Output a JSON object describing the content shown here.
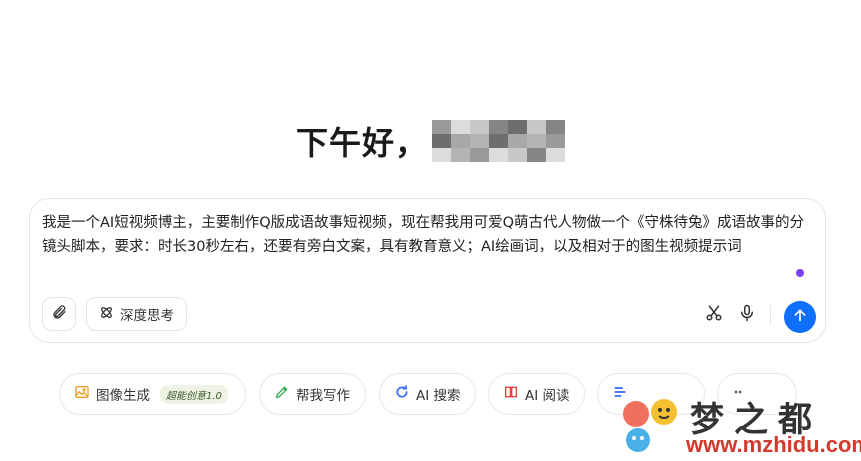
{
  "greeting": {
    "text": "下午好，"
  },
  "composer": {
    "prompt": "我是一个AI短视频博主，主要制作Q版成语故事短视频，现在帮我用可爱Q萌古代人物做一个《守株待兔》成语故事的分镜头脚本，要求：时长30秒左右，还要有旁白文案，具有教育意义；AI绘画词，以及相对于的图生视频提示词",
    "think_label": "深度思考",
    "icons": {
      "attach": "paperclip-icon",
      "think": "atom-icon",
      "cut": "scissors-icon",
      "mic": "microphone-icon",
      "send": "arrow-up-icon"
    },
    "accent_color": "#0f6fff"
  },
  "chips": [
    {
      "label": "图像生成",
      "badge": "超能创意1.0",
      "icon": "image-icon",
      "color": "#f0a020"
    },
    {
      "label": "帮我写作",
      "icon": "pen-icon",
      "color": "#2faa55"
    },
    {
      "label": "AI 搜索",
      "icon": "search-icon",
      "color": "#2f6bff"
    },
    {
      "label": "AI 阅读",
      "icon": "book-icon",
      "color": "#e8453c"
    },
    {
      "label": "",
      "icon": "edit-icon",
      "color": "#2f6bff"
    },
    {
      "label": "",
      "icon": "more-icon",
      "color": "#555"
    }
  ],
  "watermark": {
    "title": "梦之都",
    "url": "www.mzhidu.com"
  }
}
